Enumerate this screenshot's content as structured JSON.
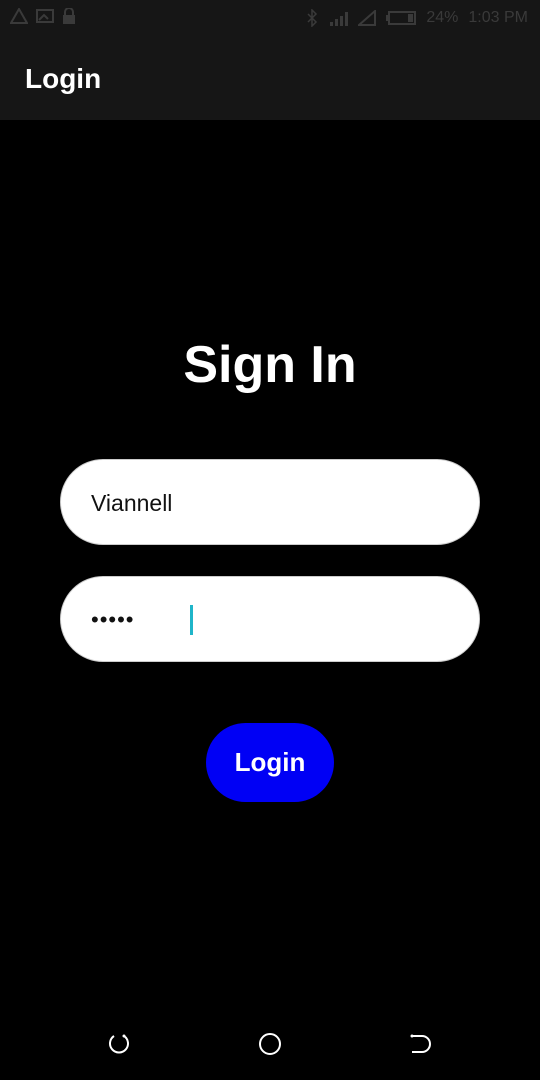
{
  "status_bar": {
    "battery": "24%",
    "time": "1:03 PM",
    "icons_left": [
      "alert-triangle-icon",
      "image-icon",
      "lock-icon"
    ],
    "icons_right": [
      "bluetooth-icon",
      "signal-icon",
      "no-signal-icon",
      "battery-icon"
    ]
  },
  "app_bar": {
    "title": "Login"
  },
  "main": {
    "heading": "Sign In",
    "username_value": "Viannell",
    "password_value": "•••••",
    "login_label": "Login"
  },
  "colors": {
    "background": "#000000",
    "bar": "#161616",
    "button": "#0000f5",
    "field": "#ffffff",
    "caret": "#1fb5c9"
  },
  "nav_bar": {
    "buttons": [
      "recent-apps-icon",
      "home-icon",
      "back-icon"
    ]
  }
}
